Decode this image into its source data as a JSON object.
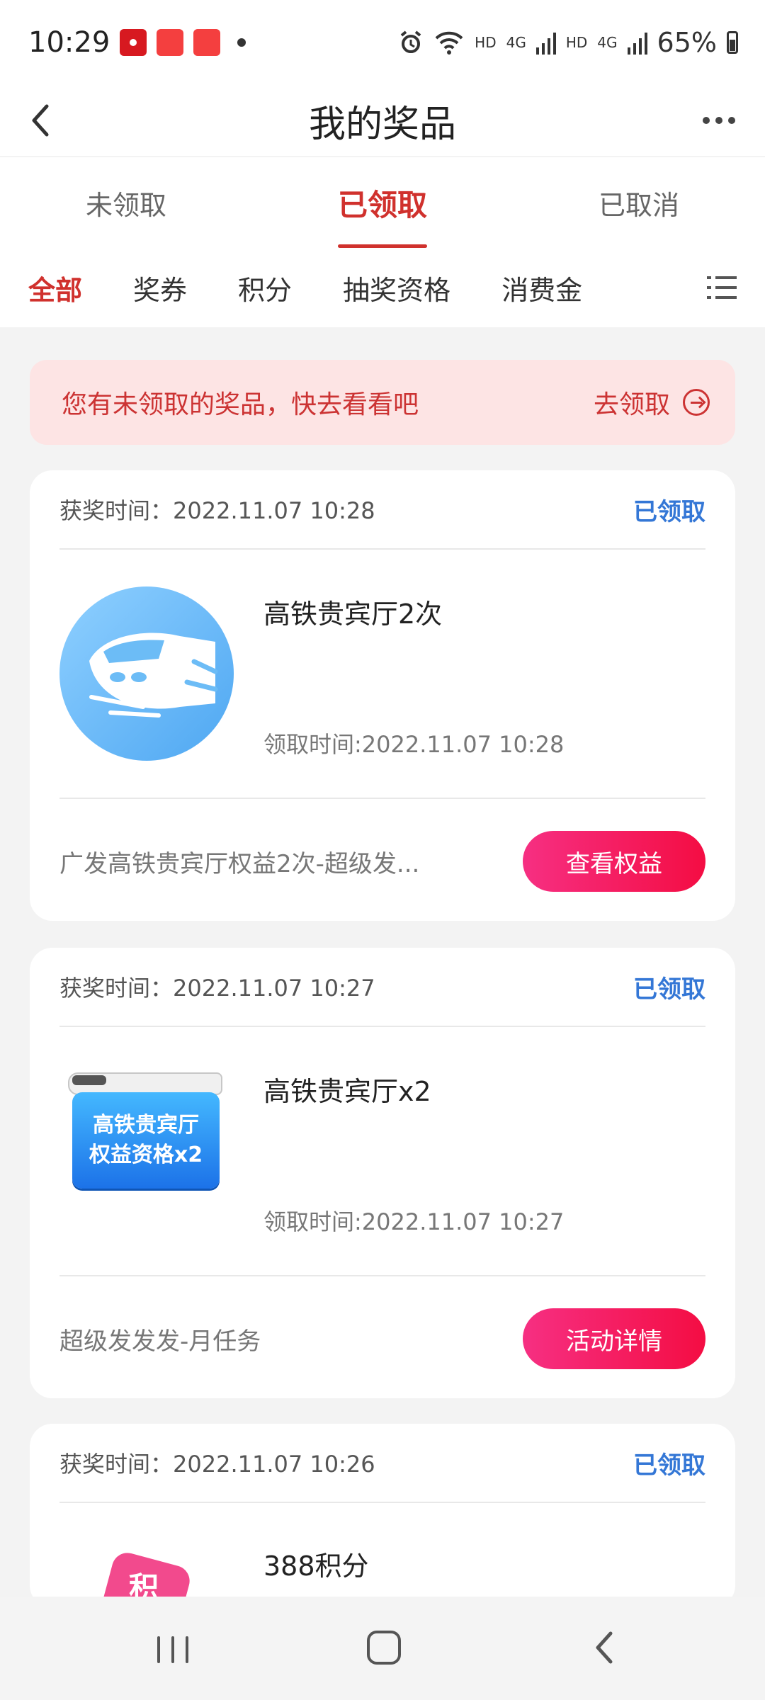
{
  "status_bar": {
    "time": "10:29",
    "hd_label_1": "HD",
    "signal_label_1": "4G",
    "hd_label_2": "HD",
    "signal_label_2": "4G",
    "battery": "65%"
  },
  "header": {
    "title": "我的奖品"
  },
  "tabs": [
    {
      "label": "未领取",
      "active": false
    },
    {
      "label": "已领取",
      "active": true
    },
    {
      "label": "已取消",
      "active": false
    }
  ],
  "filters": [
    {
      "label": "全部",
      "active": true
    },
    {
      "label": "奖券",
      "active": false
    },
    {
      "label": "积分",
      "active": false
    },
    {
      "label": "抽奖资格",
      "active": false
    },
    {
      "label": "消费金",
      "active": false
    }
  ],
  "notice": {
    "text": "您有未领取的奖品，快去看看吧",
    "action": "去领取"
  },
  "cards": [
    {
      "award_time": "获奖时间：2022.11.07 10:28",
      "status": "已领取",
      "prize_name": "高铁贵宾厅2次",
      "claim_time": "领取时间:2022.11.07 10:28",
      "description": "广发高铁贵宾厅权益2次-超级发...",
      "button": "查看权益"
    },
    {
      "award_time": "获奖时间：2022.11.07 10:27",
      "status": "已领取",
      "prize_name": "高铁贵宾厅x2",
      "image_text_line1": "高铁贵宾厅",
      "image_text_line2": "权益资格x2",
      "claim_time": "领取时间:2022.11.07 10:27",
      "description": "超级发发发-月任务",
      "button": "活动详情"
    },
    {
      "award_time": "获奖时间：2022.11.07 10:26",
      "status": "已领取",
      "prize_name": "388积分",
      "image_text": "积"
    }
  ],
  "colors": {
    "accent": "#d0312d",
    "status_blue": "#3477d6",
    "button_start": "#f62f82",
    "button_end": "#f40d43"
  }
}
